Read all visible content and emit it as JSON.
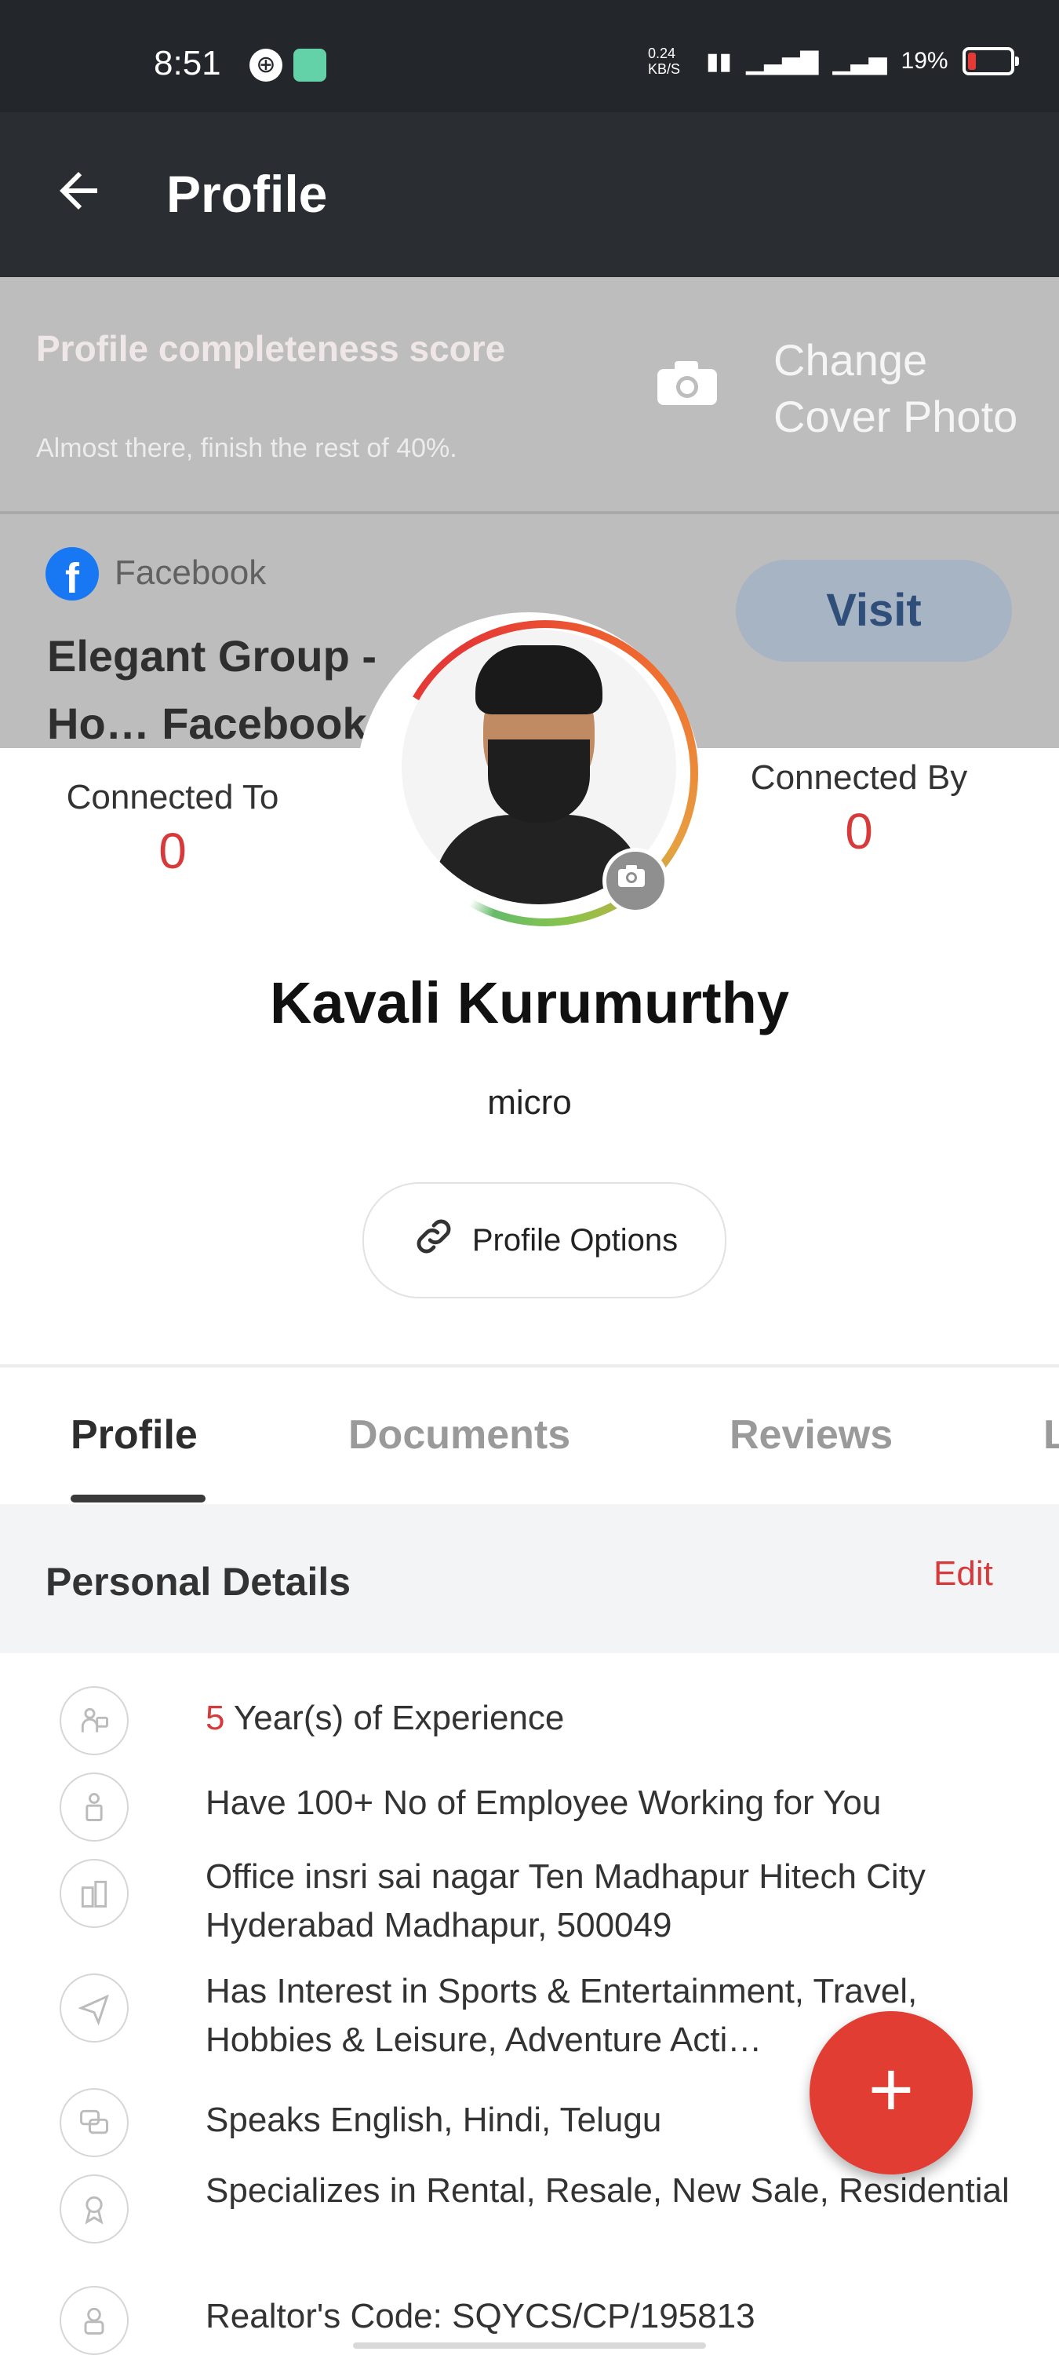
{
  "status_bar": {
    "time": "8:51",
    "network_speed": "0.24 KB/S",
    "battery_percent": "19%"
  },
  "header": {
    "back_icon": "back-arrow-icon",
    "title": "Profile"
  },
  "cover": {
    "score_title": "Profile completeness score",
    "score_subtitle": "Almost there, finish the rest of 40%.",
    "change_cover_label": "Change Cover Photo",
    "social": {
      "platform": "Facebook",
      "title": "Elegant Group - Ho… Facebook",
      "visit_label": "Visit"
    }
  },
  "connections": {
    "connected_to_label": "Connected To",
    "connected_to_value": "0",
    "connected_by_label": "Connected By",
    "connected_by_value": "0"
  },
  "profile": {
    "name": "Kavali Kurumurthy",
    "subtitle": "micro",
    "options_label": "Profile Options",
    "completeness_percent": 60
  },
  "tabs": [
    {
      "label": "Profile",
      "active": true
    },
    {
      "label": "Documents",
      "active": false
    },
    {
      "label": "Reviews",
      "active": false
    },
    {
      "label": "L",
      "active": false
    }
  ],
  "personal_details": {
    "title": "Personal Details",
    "edit_label": "Edit",
    "items": [
      {
        "icon": "experience-icon",
        "highlight": "5",
        "text": " Year(s) of Experience"
      },
      {
        "icon": "employee-icon",
        "text": "Have 100+ No of Employee Working for You"
      },
      {
        "icon": "office-icon",
        "text": "Office insri sai nagar Ten Madhapur Hitech City Hyderabad Madhapur, 500049"
      },
      {
        "icon": "interest-icon",
        "text": "Has Interest in Sports & Entertainment, Travel, Hobbies & Leisure, Adventure Acti…"
      },
      {
        "icon": "language-icon",
        "text": "Speaks English, Hindi, Telugu"
      },
      {
        "icon": "specialization-icon",
        "text": "Specializes in Rental, Resale, New Sale, Residential"
      },
      {
        "icon": "realtor-code-icon",
        "text": "Realtor's Code: SQYCS/CP/195813"
      }
    ]
  },
  "fab": {
    "label": "+"
  },
  "colors": {
    "accent": "#d63a3a",
    "header_bg": "#2a2d31",
    "cover_bg": "#bdbdbd",
    "facebook": "#1877f2"
  }
}
